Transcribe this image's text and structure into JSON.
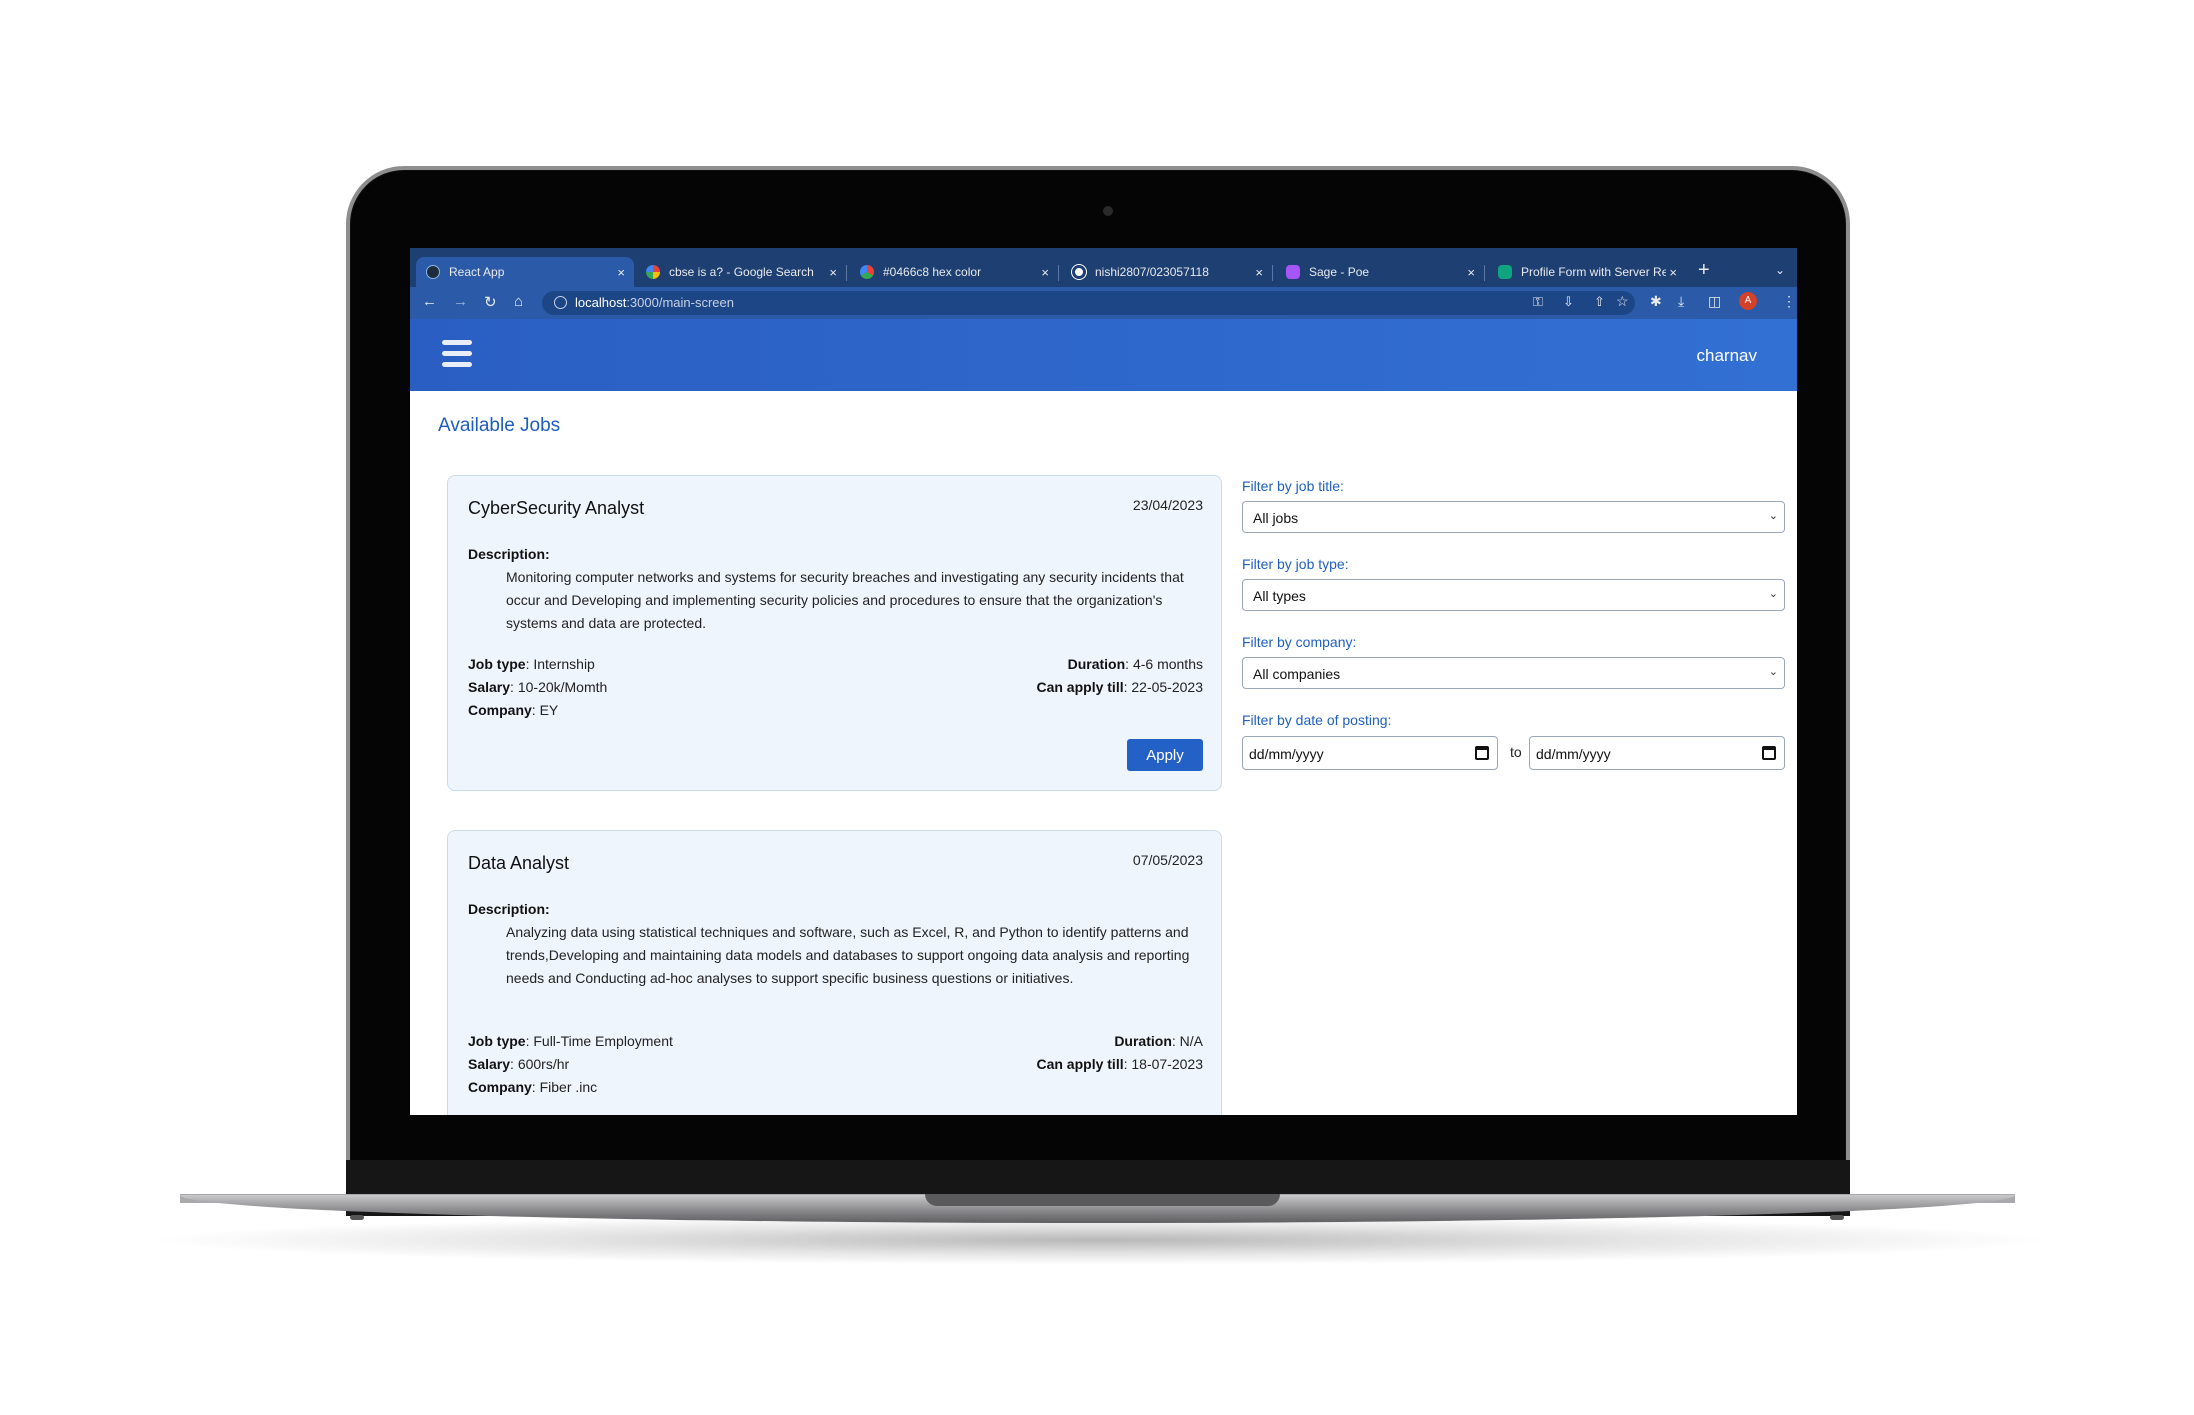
{
  "browser": {
    "tabs": [
      {
        "label": "React App",
        "active": true,
        "favicon_color": "#1d2b3a"
      },
      {
        "label": "cbse is a? - Google Search",
        "active": false,
        "favicon_color": "#ea4335"
      },
      {
        "label": "#0466c8 hex color",
        "active": false,
        "favicon_color": "#34a853"
      },
      {
        "label": "nishi2807/023057118",
        "active": false,
        "favicon_color": "#ffffff"
      },
      {
        "label": "Sage - Poe",
        "active": false,
        "favicon_color": "#a855f7"
      },
      {
        "label": "Profile Form with Server Re",
        "active": false,
        "favicon_color": "#10a37f"
      }
    ],
    "close_glyph": "×",
    "new_tab_glyph": "+",
    "url_host": "localhost",
    "url_path": ":3000/main-screen",
    "profile_initial": "A"
  },
  "app": {
    "username": "charnav",
    "page_title": "Available Jobs",
    "accent_color": "#2461c7"
  },
  "jobs": [
    {
      "title": "CyberSecurity Analyst",
      "date": "23/04/2023",
      "description_label": "Description:",
      "description": "Monitoring computer networks and systems for security breaches and investigating any security incidents that occur and Developing and implementing security policies and procedures to ensure that the organization's systems and data are protected.",
      "job_type_label": "Job type",
      "job_type": "Internship",
      "salary_label": "Salary",
      "salary": "10-20k/Momth",
      "company_label": "Company",
      "company": "EY",
      "duration_label": "Duration",
      "duration": "4-6 months",
      "apply_till_label": "Can apply till",
      "apply_till": "22-05-2023",
      "apply_label": "Apply"
    },
    {
      "title": "Data Analyst",
      "date": "07/05/2023",
      "description_label": "Description:",
      "description": "Analyzing data using statistical techniques and software, such as Excel, R, and Python to identify patterns and trends,Developing and maintaining data models and databases to support ongoing data analysis and reporting needs and Conducting ad-hoc analyses to support specific business questions or initiatives.",
      "job_type_label": "Job type",
      "job_type": "Full-Time Employment",
      "salary_label": "Salary",
      "salary": "600rs/hr",
      "company_label": "Company",
      "company": "Fiber .inc",
      "duration_label": "Duration",
      "duration": "N/A",
      "apply_till_label": "Can apply till",
      "apply_till": "18-07-2023"
    }
  ],
  "filters": {
    "job_title": {
      "label": "Filter by job title:",
      "value": "All jobs"
    },
    "job_type": {
      "label": "Filter by job type:",
      "value": "All types"
    },
    "company": {
      "label": "Filter by company:",
      "value": "All companies"
    },
    "date": {
      "label": "Filter by date of posting:",
      "from_placeholder": "dd/mm/yyyy",
      "to_placeholder": "dd/mm/yyyy",
      "to_label": "to"
    }
  }
}
